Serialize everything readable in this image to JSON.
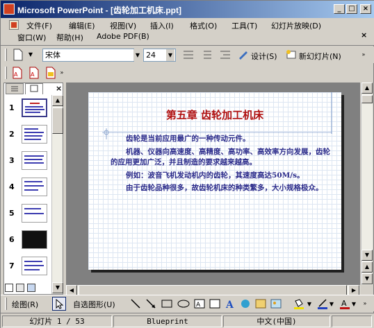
{
  "window": {
    "title": "Microsoft PowerPoint - [齿轮加工机床.ppt]",
    "minimize": "_",
    "maximize": "□",
    "close": "×"
  },
  "menu": {
    "row1": [
      "文件(F)",
      "编辑(E)",
      "视图(V)",
      "插入(I)",
      "格式(O)",
      "工具(T)",
      "幻灯片放映(D)"
    ],
    "row2": [
      "窗口(W)",
      "帮助(H)",
      "Adobe PDF(B)"
    ],
    "close_doc": "×"
  },
  "formatting": {
    "font": "宋体",
    "size": "24",
    "design_label": "设计(S)",
    "new_slide_label": "新幻灯片(N)"
  },
  "outline_tabs": {
    "outline_icon": "outline-icon",
    "slides_icon": "slides-icon"
  },
  "close_pane": "×",
  "slides": {
    "numbers": [
      "1",
      "2",
      "3",
      "4",
      "5",
      "6",
      "7"
    ]
  },
  "slide": {
    "title": "第五章    齿轮加工机床",
    "paragraphs": [
      "齿轮是当前应用最广的一种传动元件。",
      "机器、仪器向高速度、高精度、高功率、高效率方向发展，齿轮的应用更加广泛，并且制造的要求越来越高。",
      "例如：波音飞机发动机内的齿轮，其速度高达50M/s。",
      "由于齿轮品种很多，故齿轮机床的种类繁多，大小规格极众。"
    ]
  },
  "drawing": {
    "draw_label": "绘图(R)",
    "autoshapes_label": "自选图形(U)"
  },
  "status": {
    "slide_info": "幻灯片 1 / 53",
    "template": "Blueprint",
    "language": "中文(中国)"
  },
  "colors": {
    "title_red": "#b01010",
    "body_blue": "#2a2a8a",
    "titlebar": "#0a246a"
  }
}
